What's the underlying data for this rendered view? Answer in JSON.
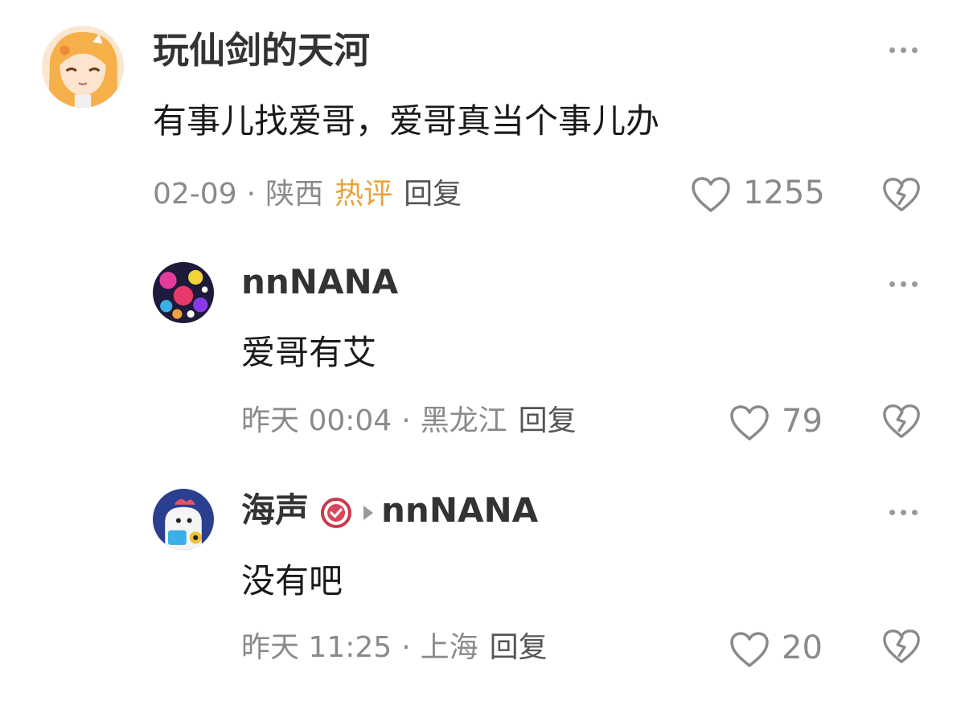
{
  "comments": [
    {
      "username": "玩仙剑的天河",
      "content": "有事儿找爱哥，爱哥真当个事儿办",
      "date": "02-09",
      "location": "陕西",
      "hot_label": "热评",
      "reply_label": "回复",
      "likes": "1255"
    },
    {
      "username": "nnNANA",
      "content": "爱哥有艾",
      "date": "昨天 00:04",
      "location": "黑龙江",
      "reply_label": "回复",
      "likes": "79"
    },
    {
      "username": "海声",
      "reply_to": "nnNANA",
      "content": "没有吧",
      "date": "昨天 11:25",
      "location": "上海",
      "reply_label": "回复",
      "likes": "20"
    }
  ],
  "separator": "·",
  "icons": {
    "more": "more-icon",
    "like": "heart-icon",
    "dislike": "broken-heart-icon",
    "verified": "verified-badge-icon",
    "reply_arrow": "reply-arrow-icon"
  },
  "colors": {
    "hot": "#e9a23b",
    "meta": "#8a8a8a",
    "username": "#333333",
    "text": "#1a1a1a"
  }
}
